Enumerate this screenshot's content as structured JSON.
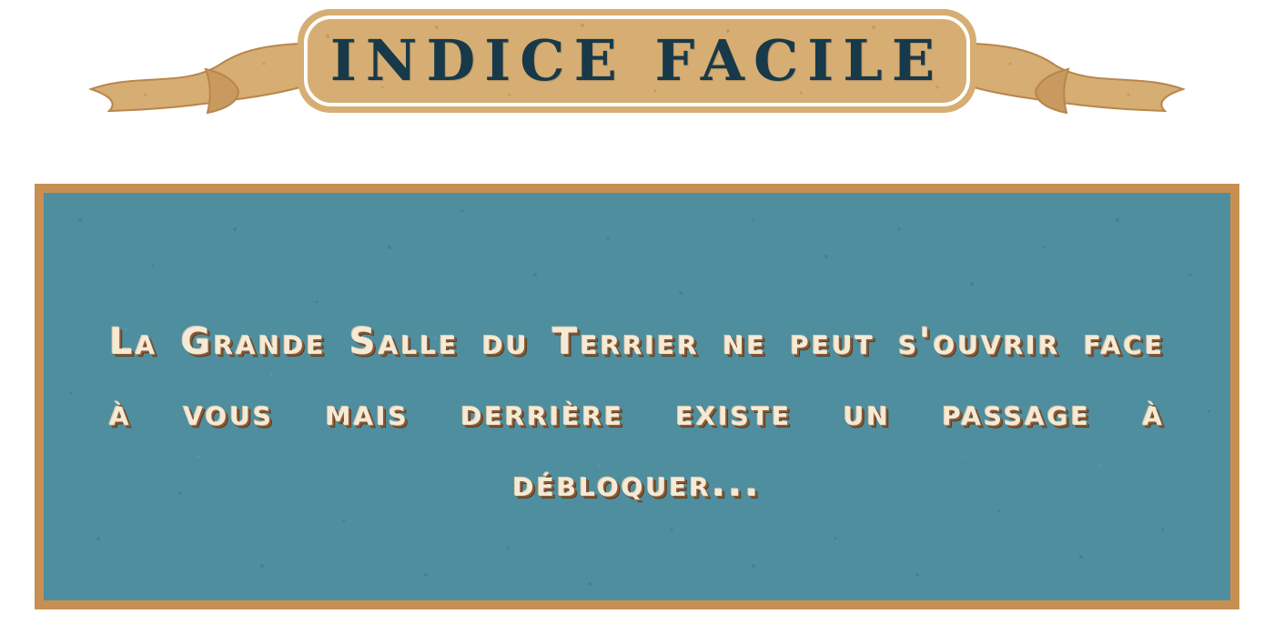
{
  "banner": {
    "title": "Indice facile"
  },
  "hint": {
    "text": "La Grande Salle du Terrier ne peut s'ouvrir face à vous mais derrière existe un passage à débloquer..."
  },
  "colors": {
    "ribbon": "#d6ad72",
    "ribbon_dark": "#b8864c",
    "title_text": "#17394a",
    "panel_border": "#c78f52",
    "panel_fill": "#4e8e9e",
    "hint_text": "#f4ead6"
  }
}
